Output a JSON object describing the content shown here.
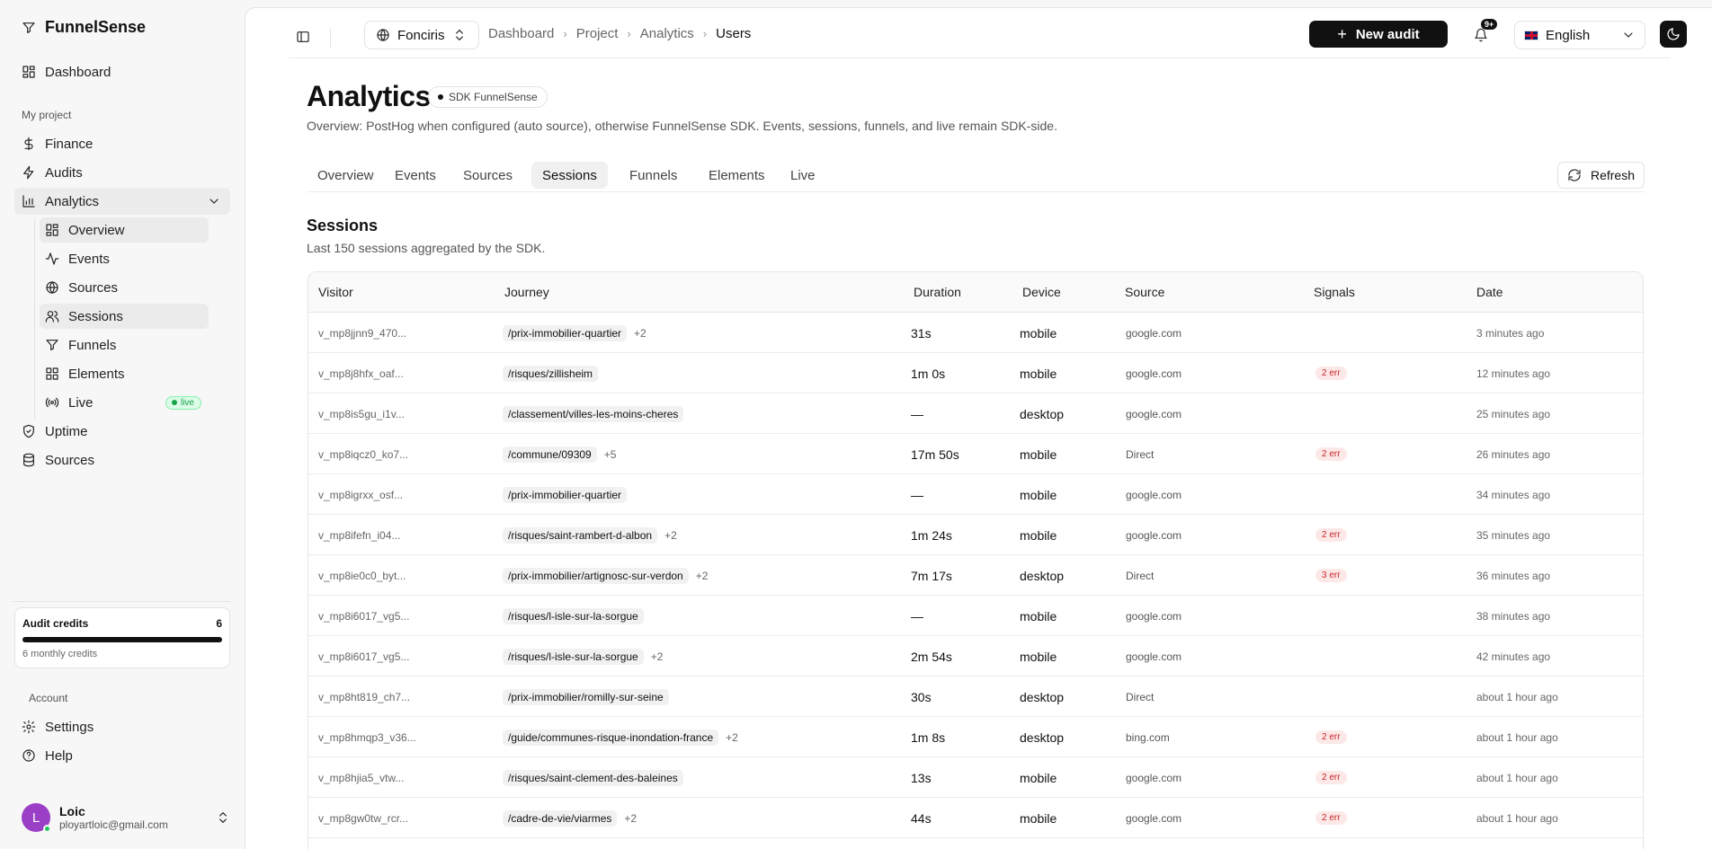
{
  "sidebar": {
    "brand": "FunnelSense",
    "dashboard": "Dashboard",
    "my_project_label": "My project",
    "finance": "Finance",
    "audits": "Audits",
    "analytics": "Analytics",
    "sub": {
      "overview": "Overview",
      "events": "Events",
      "sources": "Sources",
      "sessions": "Sessions",
      "funnels": "Funnels",
      "elements": "Elements",
      "live": "Live",
      "live_badge": "live"
    },
    "uptime": "Uptime",
    "sources": "Sources",
    "credits": {
      "title": "Audit credits",
      "count": "6",
      "sub": "6 monthly credits",
      "fill_fraction": 1.0
    },
    "account_label": "Account",
    "settings": "Settings",
    "help": "Help",
    "user": {
      "initial": "L",
      "name": "Loic",
      "email": "ployartloic@gmail.com"
    }
  },
  "topbar": {
    "project": "Fonciris",
    "breadcrumbs": [
      "Dashboard",
      "Project",
      "Analytics",
      "Users"
    ],
    "new_audit": "New audit",
    "notif_badge": "9+",
    "language": "English"
  },
  "page": {
    "title": "Analytics",
    "badge": "SDK FunnelSense",
    "subtitle": "Overview: PostHog when configured (auto source), otherwise FunnelSense SDK. Events, sessions, funnels, and live remain SDK-side.",
    "tabs": [
      "Overview",
      "Events",
      "Sources",
      "Sessions",
      "Funnels",
      "Elements",
      "Live"
    ],
    "active_tab": "Sessions",
    "refresh": "Refresh"
  },
  "sessions": {
    "title": "Sessions",
    "subtitle": "Last 150 sessions aggregated by the SDK.",
    "columns": [
      "Visitor",
      "Journey",
      "Duration",
      "Device",
      "Source",
      "Signals",
      "Date"
    ],
    "rows": [
      {
        "visitor": "v_mp8jjnn9_470...",
        "path": "/prix-immobilier-quartier",
        "more": "+2",
        "duration": "31s",
        "device": "mobile",
        "source": "google.com",
        "signal": "",
        "date": "3 minutes ago"
      },
      {
        "visitor": "v_mp8j8hfx_oaf...",
        "path": "/risques/zillisheim",
        "more": "",
        "duration": "1m 0s",
        "device": "mobile",
        "source": "google.com",
        "signal": "2 err",
        "date": "12 minutes ago"
      },
      {
        "visitor": "v_mp8is5gu_i1v...",
        "path": "/classement/villes-les-moins-cheres",
        "more": "",
        "duration": "—",
        "device": "desktop",
        "source": "google.com",
        "signal": "",
        "date": "25 minutes ago"
      },
      {
        "visitor": "v_mp8iqcz0_ko7...",
        "path": "/commune/09309",
        "more": "+5",
        "duration": "17m 50s",
        "device": "mobile",
        "source": "Direct",
        "signal": "2 err",
        "date": "26 minutes ago"
      },
      {
        "visitor": "v_mp8igrxx_osf...",
        "path": "/prix-immobilier-quartier",
        "more": "",
        "duration": "—",
        "device": "mobile",
        "source": "google.com",
        "signal": "",
        "date": "34 minutes ago"
      },
      {
        "visitor": "v_mp8ifefn_i04...",
        "path": "/risques/saint-rambert-d-albon",
        "more": "+2",
        "duration": "1m 24s",
        "device": "mobile",
        "source": "google.com",
        "signal": "2 err",
        "date": "35 minutes ago"
      },
      {
        "visitor": "v_mp8ie0c0_byt...",
        "path": "/prix-immobilier/artignosc-sur-verdon",
        "more": "+2",
        "duration": "7m 17s",
        "device": "desktop",
        "source": "Direct",
        "signal": "3 err",
        "date": "36 minutes ago"
      },
      {
        "visitor": "v_mp8i6017_vg5...",
        "path": "/risques/l-isle-sur-la-sorgue",
        "more": "",
        "duration": "—",
        "device": "mobile",
        "source": "google.com",
        "signal": "",
        "date": "38 minutes ago"
      },
      {
        "visitor": "v_mp8i6017_vg5...",
        "path": "/risques/l-isle-sur-la-sorgue",
        "more": "+2",
        "duration": "2m 54s",
        "device": "mobile",
        "source": "google.com",
        "signal": "",
        "date": "42 minutes ago"
      },
      {
        "visitor": "v_mp8ht819_ch7...",
        "path": "/prix-immobilier/romilly-sur-seine",
        "more": "",
        "duration": "30s",
        "device": "desktop",
        "source": "Direct",
        "signal": "",
        "date": "about 1 hour ago"
      },
      {
        "visitor": "v_mp8hmqp3_v36...",
        "path": "/guide/communes-risque-inondation-france",
        "more": "+2",
        "duration": "1m 8s",
        "device": "desktop",
        "source": "bing.com",
        "signal": "2 err",
        "date": "about 1 hour ago"
      },
      {
        "visitor": "v_mp8hjia5_vtw...",
        "path": "/risques/saint-clement-des-baleines",
        "more": "",
        "duration": "13s",
        "device": "mobile",
        "source": "google.com",
        "signal": "2 err",
        "date": "about 1 hour ago"
      },
      {
        "visitor": "v_mp8gw0tw_rcr...",
        "path": "/cadre-de-vie/viarmes",
        "more": "+2",
        "duration": "44s",
        "device": "mobile",
        "source": "google.com",
        "signal": "2 err",
        "date": "about 1 hour ago"
      },
      {
        "visitor": "",
        "path": "",
        "more": "",
        "duration": "",
        "device": "",
        "source": "",
        "signal": "",
        "date": ""
      }
    ]
  }
}
